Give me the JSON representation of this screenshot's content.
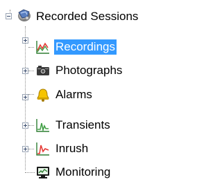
{
  "tree": {
    "root": {
      "label": "Recorded Sessions",
      "icon": "globe-folder-icon",
      "expanded": true
    },
    "children": [
      {
        "label": "Recordings",
        "icon": "waveform-chart-icon",
        "selected": true,
        "expander": "plus"
      },
      {
        "label": "Photographs",
        "icon": "camera-icon",
        "selected": false,
        "expander": "plus"
      },
      {
        "label": "Alarms",
        "icon": "bell-icon",
        "selected": false,
        "expander": "plus"
      },
      {
        "label": "Transients",
        "icon": "transient-chart-icon",
        "selected": false,
        "expander": "plus"
      },
      {
        "label": "Inrush",
        "icon": "inrush-chart-icon",
        "selected": false,
        "expander": "plus"
      },
      {
        "label": "Monitoring",
        "icon": "monitor-icon",
        "selected": false,
        "expander": "none"
      }
    ]
  },
  "colors": {
    "selection": "#3399ff",
    "treeline": "#8c8c8c"
  }
}
